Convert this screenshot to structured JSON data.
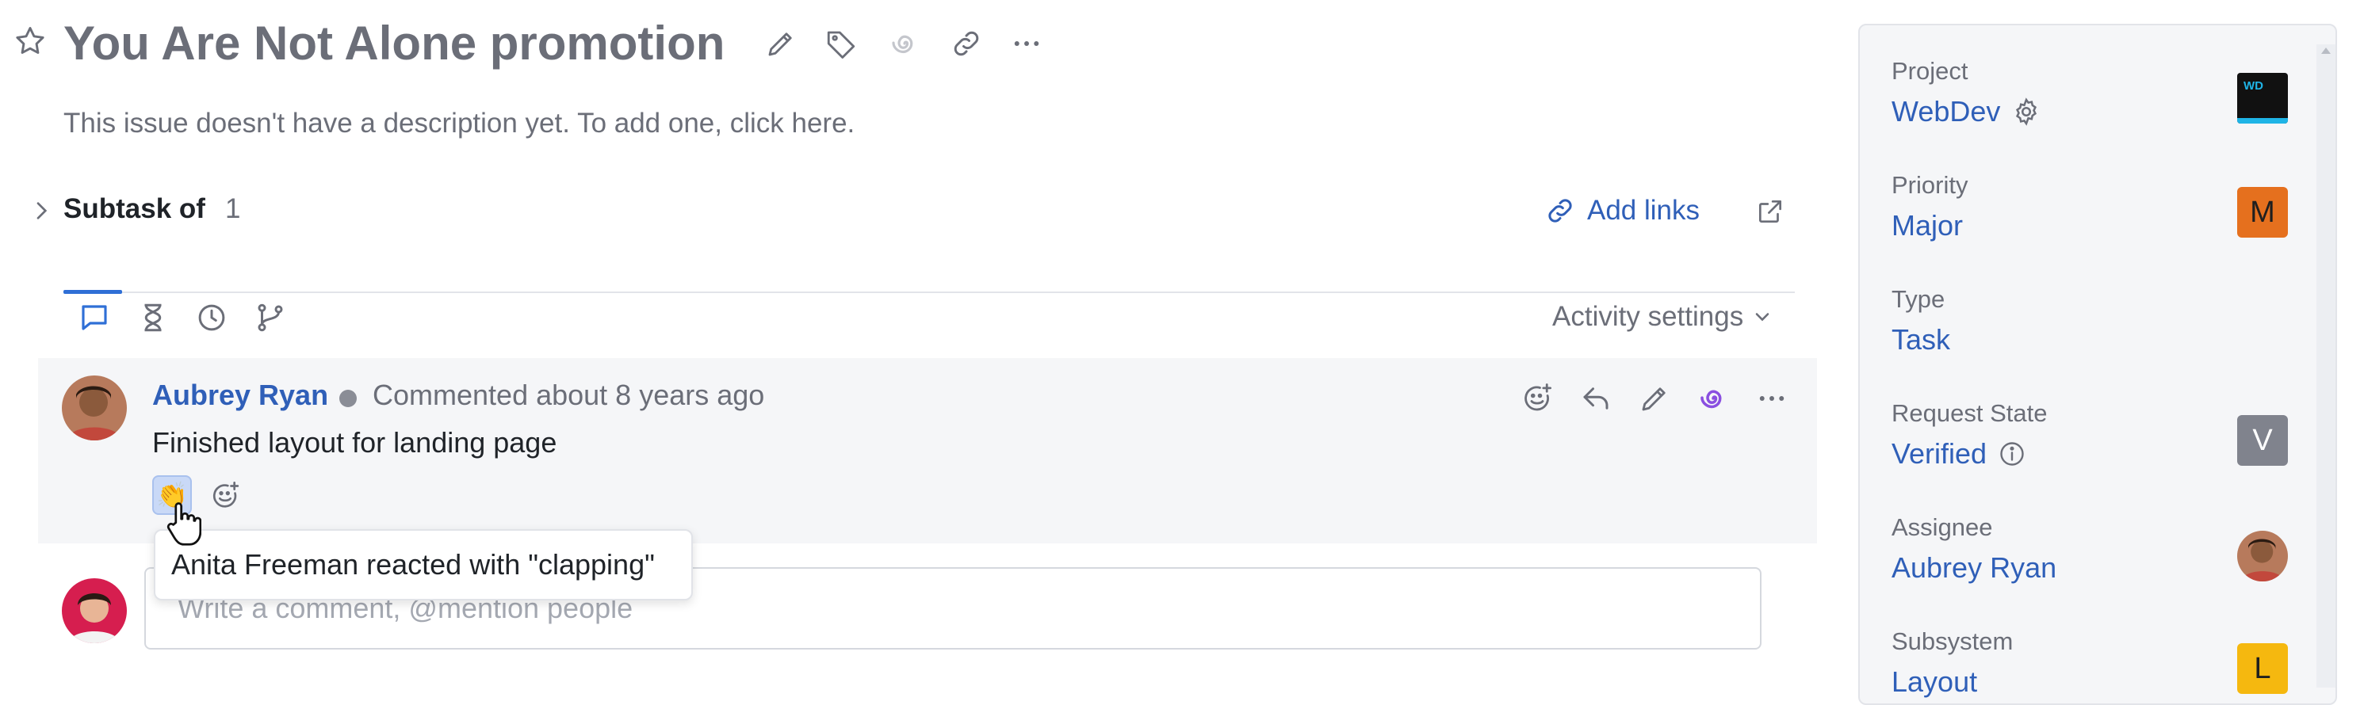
{
  "issue": {
    "title": "You Are Not Alone promotion",
    "description": "This issue doesn't have a description yet. To add one, click here."
  },
  "links": {
    "subtask_label": "Subtask of",
    "subtask_count": "1",
    "add_links_label": "Add links"
  },
  "activity": {
    "settings_label": "Activity settings"
  },
  "comment": {
    "author": "Aubrey Ryan",
    "meta": "Commented about 8 years ago",
    "text": "Finished layout for landing page",
    "reaction_emoji": "👏",
    "tooltip": "Anita Freeman reacted with \"clapping\""
  },
  "composer": {
    "placeholder": "Write a comment, @mention people"
  },
  "sidebar": {
    "fields": [
      {
        "label": "Project",
        "value": "WebDev",
        "badge": "WD"
      },
      {
        "label": "Priority",
        "value": "Major",
        "badge": "M"
      },
      {
        "label": "Type",
        "value": "Task"
      },
      {
        "label": "Request State",
        "value": "Verified",
        "badge": "V"
      },
      {
        "label": "Assignee",
        "value": "Aubrey Ryan"
      },
      {
        "label": "Subsystem",
        "value": "Layout",
        "badge": "L"
      }
    ]
  },
  "colors": {
    "link": "#2f5fb8",
    "priority_badge": "#e5701e",
    "state_badge": "#80838d",
    "subsystem_badge": "#f5b80f",
    "project_badge_bg": "#111111",
    "project_badge_accent": "#1fb4e6",
    "ai_icon": "#8a4fe0"
  }
}
